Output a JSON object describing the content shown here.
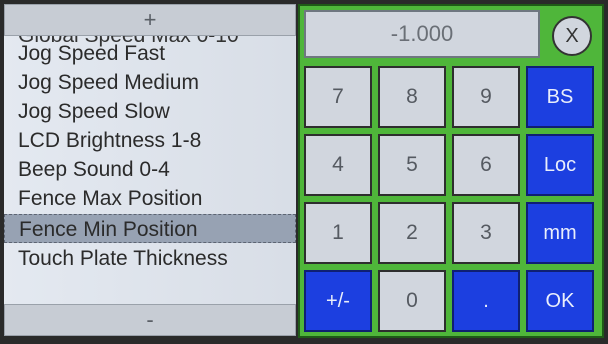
{
  "menu": {
    "scroll_up_label": "+",
    "scroll_down_label": "-",
    "partial_top_item": "Global Speed Max 0-10",
    "items": [
      {
        "label": "Jog Speed Fast"
      },
      {
        "label": "Jog Speed Medium"
      },
      {
        "label": "Jog Speed Slow"
      },
      {
        "label": "LCD Brightness 1-8"
      },
      {
        "label": "Beep Sound 0-4"
      },
      {
        "label": "Fence Max Position"
      },
      {
        "label": "Fence Min Position",
        "selected": true
      },
      {
        "label": "Touch Plate Thickness"
      }
    ]
  },
  "keypad": {
    "display_value": "-1.000",
    "close_label": "X",
    "keys": [
      {
        "label": "7"
      },
      {
        "label": "8"
      },
      {
        "label": "9"
      },
      {
        "label": "BS"
      },
      {
        "label": "4"
      },
      {
        "label": "5"
      },
      {
        "label": "6"
      },
      {
        "label": "Loc"
      },
      {
        "label": "1"
      },
      {
        "label": "2"
      },
      {
        "label": "3"
      },
      {
        "label": "mm"
      },
      {
        "label": "+/-"
      },
      {
        "label": "0"
      },
      {
        "label": "."
      },
      {
        "label": "OK"
      }
    ]
  },
  "colors": {
    "keypad_background": "#4fb63a",
    "function_key": "#1c3fe0",
    "number_key": "#d1d6de",
    "menu_background": "#dfe5ee",
    "menu_selected": "#97a2b3"
  }
}
